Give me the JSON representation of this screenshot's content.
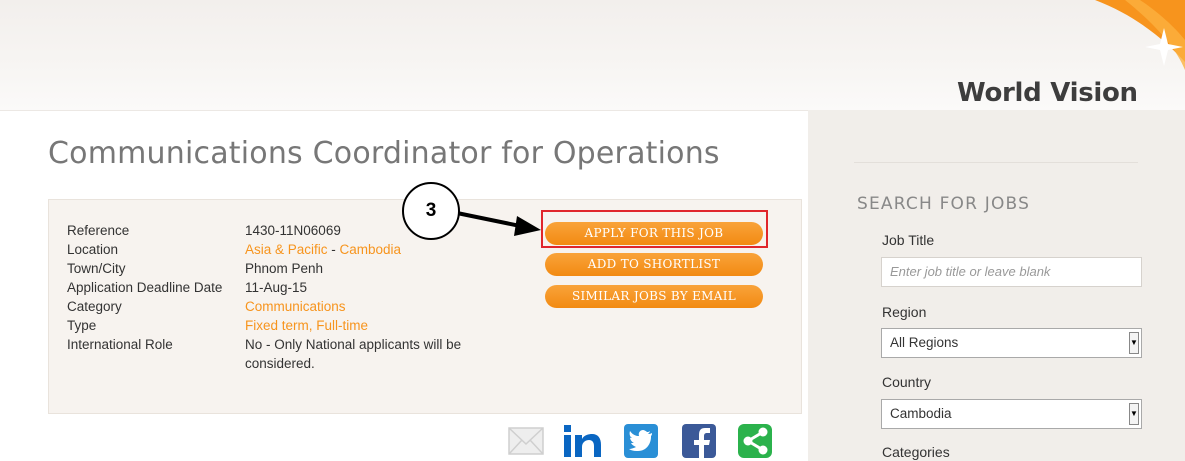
{
  "brand": {
    "logo_text": "World Vision",
    "accent_color": "#f7941d"
  },
  "job": {
    "title": "Communications Coordinator for Operations",
    "details": [
      {
        "label": "Reference",
        "value": "1430-11N06069"
      },
      {
        "label": "Location",
        "region": "Asia & Pacific",
        "separator": " - ",
        "country": "Cambodia"
      },
      {
        "label": "Town/City",
        "value": "Phnom Penh"
      },
      {
        "label": "Application Deadline Date",
        "value": "11-Aug-15"
      },
      {
        "label": "Category",
        "value": "Communications"
      },
      {
        "label": "Type",
        "value": "Fixed term, Full-time"
      },
      {
        "label": "International Role",
        "value": "No - Only National applicants will be considered."
      }
    ],
    "buttons": {
      "apply": "APPLY FOR THIS JOB",
      "shortlist": "ADD TO SHORTLIST",
      "similar": "SIMILAR JOBS BY EMAIL"
    }
  },
  "annotation": {
    "step_number": "3",
    "highlight_color": "#e0262c"
  },
  "share_icons": [
    "email-icon",
    "linkedin-icon",
    "twitter-icon",
    "facebook-icon",
    "share-icon"
  ],
  "sidebar": {
    "title": "SEARCH FOR JOBS",
    "job_title_label": "Job Title",
    "job_title_placeholder": "Enter job title or leave blank",
    "region_label": "Region",
    "region_value": "All Regions",
    "country_label": "Country",
    "country_value": "Cambodia",
    "categories_label": "Categories"
  }
}
